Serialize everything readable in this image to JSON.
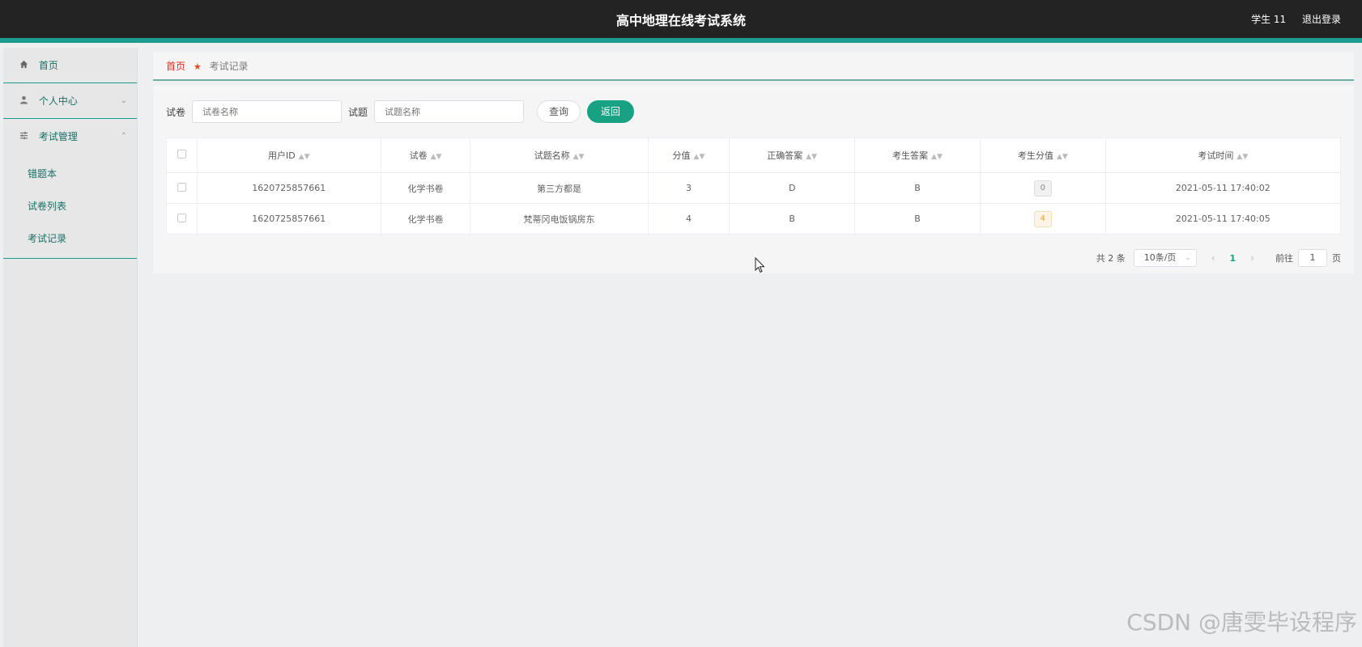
{
  "header": {
    "title": "高中地理在线考试系统",
    "user": "学生 11",
    "logout": "退出登录"
  },
  "sidebar": {
    "items": [
      {
        "label": "首页",
        "icon": "home-icon"
      },
      {
        "label": "个人中心",
        "icon": "user-icon"
      },
      {
        "label": "考试管理",
        "icon": "sliders-icon"
      }
    ],
    "submenu": [
      "错题本",
      "试卷列表",
      "考试记录"
    ]
  },
  "breadcrumb": {
    "home": "首页",
    "current": "考试记录"
  },
  "search": {
    "paper_label": "试卷",
    "paper_placeholder": "试卷名称",
    "question_label": "试题",
    "question_placeholder": "试题名称",
    "query_button": "查询",
    "back_button": "返回"
  },
  "table": {
    "columns": [
      "用户ID",
      "试卷",
      "试题名称",
      "分值",
      "正确答案",
      "考生答案",
      "考生分值",
      "考试时间"
    ],
    "rows": [
      [
        "1620725857661",
        "化学书卷",
        "第三方都是",
        "3",
        "D",
        "B",
        "0",
        "2021-05-11 17:40:02"
      ],
      [
        "1620725857661",
        "化学书卷",
        "梵蒂冈电饭锅房东",
        "4",
        "B",
        "B",
        "4",
        "2021-05-11 17:40:05"
      ]
    ]
  },
  "pagination": {
    "total": "共 2 条",
    "page_size": "10条/页",
    "current_page": "1",
    "goto_label": "前往",
    "goto_value": "1",
    "page_suffix": "页"
  },
  "watermark": "CSDN @唐雯毕设程序",
  "colors": {
    "accent": "#18a283",
    "header_bg": "#232323",
    "breadcrumb_home": "#d9331a"
  }
}
